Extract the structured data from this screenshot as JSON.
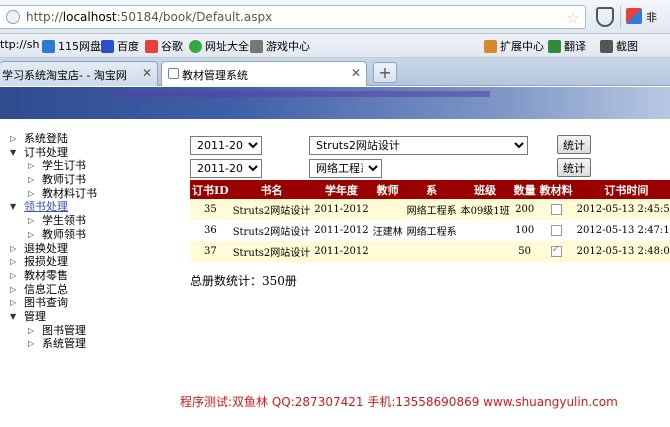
{
  "browser": {
    "url_prefix": "http://",
    "url_host": "localhost",
    "url_rest": ":50184/book/Default.aspx",
    "search_label": "非",
    "bookmarks": [
      {
        "label": "ttp://sh",
        "icon": "globe-icon",
        "color": ""
      },
      {
        "label": "115网盘",
        "icon": "cloud-icon",
        "color": "#2a7ad6"
      },
      {
        "label": "百度",
        "icon": "baidu-paw-icon",
        "color": "#2b4fc9"
      },
      {
        "label": "谷歌",
        "icon": "google-icon",
        "color": "#e8413c"
      },
      {
        "label": "网址大全",
        "icon": "ring-icon",
        "color": "#36a843"
      },
      {
        "label": "游戏中心",
        "icon": "gamepad-icon",
        "color": "#777777"
      },
      {
        "label": "扩展中心",
        "icon": "extension-icon",
        "color": "#d9882a"
      },
      {
        "label": "翻译",
        "icon": "translate-icon",
        "color": "#2e8b3a"
      },
      {
        "label": "截图",
        "icon": "scissors-icon",
        "color": "#555555"
      }
    ],
    "tabs": [
      {
        "label": "学习系统淘宝店- - 淘宝网",
        "active": false
      },
      {
        "label": "教材管理系统",
        "active": true
      }
    ]
  },
  "sidebar": {
    "items": [
      {
        "label": "系统登陆",
        "level": 0,
        "expanded": false,
        "link": false
      },
      {
        "label": "订书处理",
        "level": 0,
        "expanded": true,
        "link": false
      },
      {
        "label": "学生订书",
        "level": 1,
        "expanded": false,
        "link": false
      },
      {
        "label": "教师订书",
        "level": 1,
        "expanded": false,
        "link": false
      },
      {
        "label": "教材料订书",
        "level": 1,
        "expanded": false,
        "link": false
      },
      {
        "label": "领书处理",
        "level": 0,
        "expanded": true,
        "link": true
      },
      {
        "label": "学生领书",
        "level": 1,
        "expanded": false,
        "link": false
      },
      {
        "label": "教师领书",
        "level": 1,
        "expanded": false,
        "link": false
      },
      {
        "label": "退换处理",
        "level": 0,
        "expanded": false,
        "link": false
      },
      {
        "label": "报损处理",
        "level": 0,
        "expanded": false,
        "link": false
      },
      {
        "label": "教材零售",
        "level": 0,
        "expanded": false,
        "link": false
      },
      {
        "label": "信息汇总",
        "level": 0,
        "expanded": false,
        "link": false
      },
      {
        "label": "图书查询",
        "level": 0,
        "expanded": false,
        "link": false
      },
      {
        "label": "管理",
        "level": 0,
        "expanded": true,
        "link": false
      },
      {
        "label": "图书管理",
        "level": 1,
        "expanded": false,
        "link": false
      },
      {
        "label": "系统管理",
        "level": 1,
        "expanded": false,
        "link": false
      }
    ]
  },
  "filters": {
    "year1": "2011-2012",
    "book": "Struts2网站设计",
    "year2": "2011-2012",
    "dept": "网络工程系",
    "button1": "统计",
    "button2": "统计"
  },
  "table": {
    "headers": [
      "订书ID",
      "书名",
      "学年度",
      "教师",
      "系",
      "班级",
      "数量",
      "教材料",
      "订书时间"
    ],
    "rows": [
      {
        "id": "35",
        "book": "Struts2网站设计",
        "year": "2011-2012",
        "teacher": "",
        "dept": "网络工程系",
        "class": "本09级1班",
        "qty": "200",
        "material": false,
        "time": "2012-05-13 2:45:58"
      },
      {
        "id": "36",
        "book": "Struts2网站设计",
        "year": "2011-2012",
        "teacher": "汪建林",
        "dept": "网络工程系",
        "class": "",
        "qty": "100",
        "material": false,
        "time": "2012-05-13 2:47:14"
      },
      {
        "id": "37",
        "book": "Struts2网站设计",
        "year": "2011-2012",
        "teacher": "",
        "dept": "",
        "class": "",
        "qty": "50",
        "material": true,
        "time": "2012-05-13 2:48:01"
      }
    ]
  },
  "summary": "总册数统计：350册",
  "credit": "程序测试:双鱼林 QQ:287307421 手机:13558690869 www.shuangyulin.com"
}
